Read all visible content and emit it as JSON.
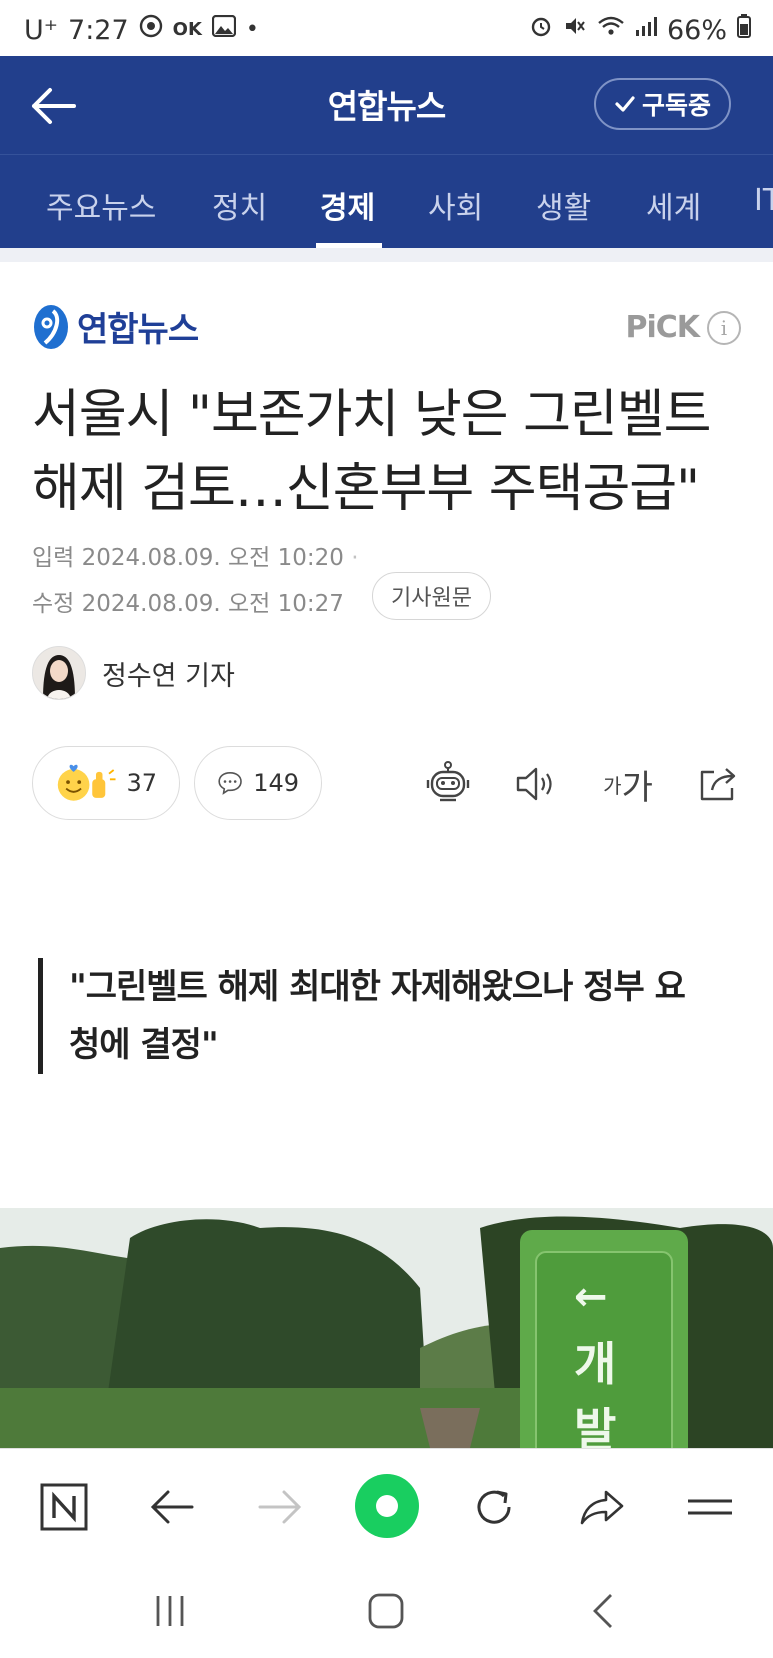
{
  "status_bar": {
    "carrier": "U⁺",
    "time": "7:27",
    "battery": "66%"
  },
  "app_bar": {
    "title": "연합뉴스",
    "subscribe_label": "구독중"
  },
  "tabs": [
    {
      "label": "주요뉴스"
    },
    {
      "label": "정치"
    },
    {
      "label": "경제",
      "active": true
    },
    {
      "label": "사회"
    },
    {
      "label": "생활"
    },
    {
      "label": "세계"
    },
    {
      "label": "IT"
    }
  ],
  "press": {
    "name": "연합뉴스",
    "pick_label": "PiCK"
  },
  "article": {
    "headline_line1": "서울시 \"보존가치 낮은 그린벨트",
    "headline_line2": "해제 검토…신혼부부 주택공급\"",
    "input_label": "입력",
    "input_datetime": "2024.08.09. 오전 10:20",
    "modified_label": "수정",
    "modified_datetime": "2024.08.09. 오전 10:27",
    "origin_button": "기사원문",
    "reporter": "정수연 기자",
    "reaction_count": "37",
    "comment_count": "149",
    "font_size_small": "가",
    "font_size_large": "가",
    "quote_line1": "\"그린벨트 해제 최대한 자제해왔으나 정부 요",
    "quote_line2": "청에 결정\"",
    "photo_sign_text_1": "←",
    "photo_sign_text_2": "개",
    "photo_sign_text_3": "발"
  },
  "colors": {
    "brand_blue": "#223f8c",
    "press_blue": "#1f3f97",
    "naver_green": "#19ce60"
  },
  "icons": {
    "back": "arrow-left-icon",
    "check": "check-icon",
    "info": "info-icon",
    "summary_bot": "robot-icon",
    "speaker": "speaker-icon",
    "share": "share-icon",
    "naver": "n-icon",
    "green_home": "green-circle-icon",
    "refresh": "refresh-icon",
    "menu": "menu-icon"
  }
}
